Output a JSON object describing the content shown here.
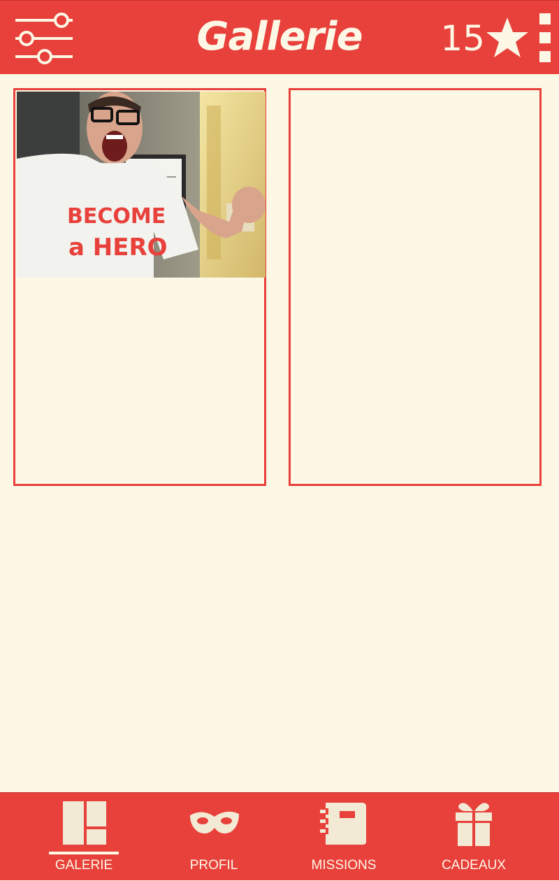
{
  "header": {
    "title": "Gallerie",
    "points": "15",
    "filter_icon": "sliders-icon",
    "points_icon": "star-icon",
    "menu_icon": "overflow-menu-icon"
  },
  "gallery": {
    "cards": [
      {
        "has_photo": true,
        "photo_shirt_text_1": "BECOME",
        "photo_shirt_text_2": "a HERO"
      },
      {
        "has_photo": false
      }
    ]
  },
  "bottom_nav": {
    "active": "GALERIE",
    "items": [
      {
        "label": "GALERIE",
        "icon": "gallery-grid-icon"
      },
      {
        "label": "PROFIL",
        "icon": "mask-icon"
      },
      {
        "label": "MISSIONS",
        "icon": "notebook-icon"
      },
      {
        "label": "CADEAUX",
        "icon": "gift-icon"
      }
    ]
  },
  "colors": {
    "primary": "#e8403b",
    "background": "#fdf8e6",
    "on_primary": "#fdf8e6",
    "icon_light": "#f2ead4"
  }
}
